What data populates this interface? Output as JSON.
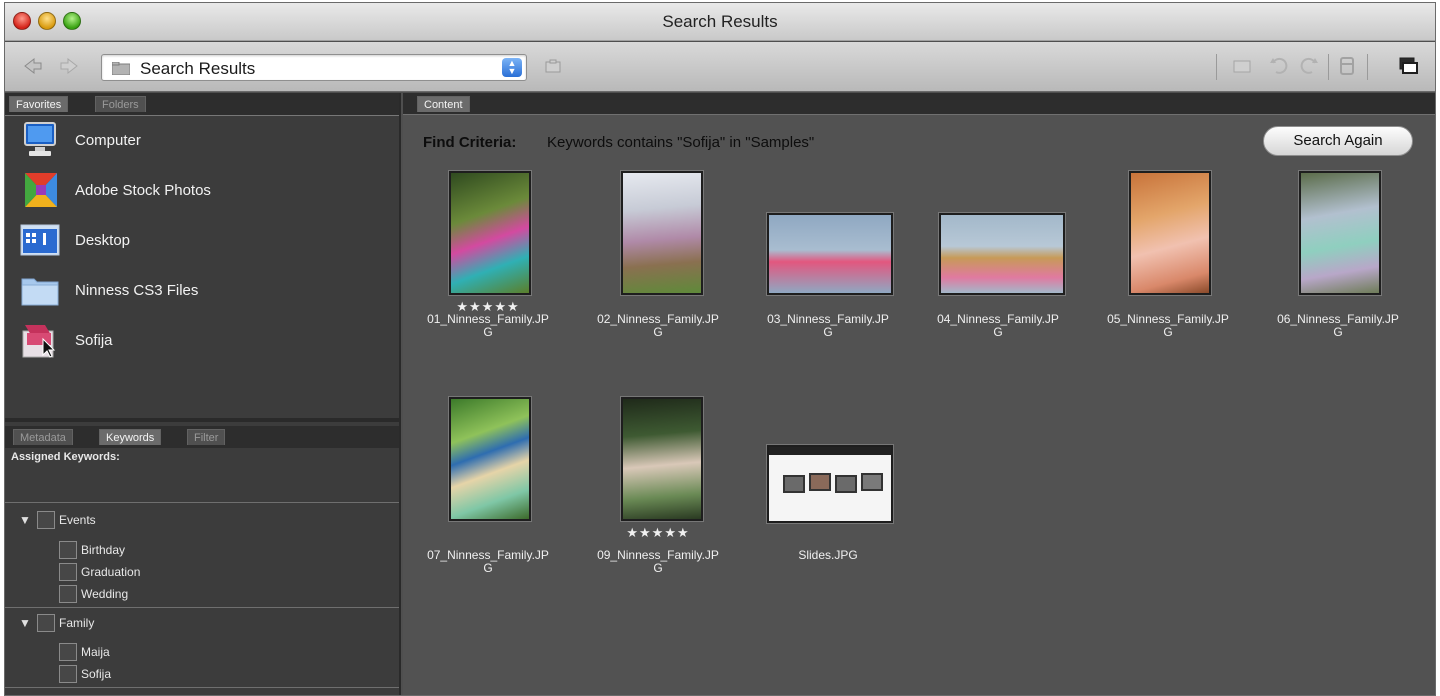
{
  "window": {
    "title": "Search Results"
  },
  "toolbar": {
    "path_text": "Search Results",
    "icons": [
      "back-arrow-icon",
      "forward-arrow-icon",
      "folder-icon",
      "dropdown-icon",
      "camera-icon",
      "thumbnail-icon",
      "rotate-left-icon",
      "rotate-right-icon",
      "trash-icon",
      "compact-mode-icon"
    ]
  },
  "left_panel": {
    "tabs": [
      "Favorites",
      "Folders"
    ],
    "favorites": [
      {
        "label": "Computer",
        "icon": "computer-icon"
      },
      {
        "label": "Adobe Stock Photos",
        "icon": "stock-photos-icon"
      },
      {
        "label": "Desktop",
        "icon": "desktop-icon"
      },
      {
        "label": "Ninness CS3 Files",
        "icon": "folder-icon"
      },
      {
        "label": "Sofija",
        "icon": "collection-icon"
      }
    ],
    "keyword_tabs": [
      "Metadata",
      "Keywords",
      "Filter"
    ],
    "assigned_label": "Assigned Keywords:",
    "keyword_groups": [
      {
        "name": "Events",
        "items": [
          "Birthday",
          "Graduation",
          "Wedding"
        ]
      },
      {
        "name": "Family",
        "items": [
          "Maija",
          "Sofija"
        ]
      }
    ]
  },
  "content": {
    "tab": "Content",
    "find_label": "Find Criteria:",
    "find_value": "Keywords contains \"Sofija\" in \"Samples\"",
    "search_again": "Search Again",
    "thumbnails": [
      {
        "name": "01_Ninness_Family.JPG",
        "line1": "01_Ninness_Family.JP",
        "line2": "G",
        "stars": "★★★★★"
      },
      {
        "name": "02_Ninness_Family.JPG",
        "line1": "02_Ninness_Family.JP",
        "line2": "G",
        "stars": ""
      },
      {
        "name": "03_Ninness_Family.JPG",
        "line1": "03_Ninness_Family.JP",
        "line2": "G",
        "stars": ""
      },
      {
        "name": "04_Ninness_Family.JPG",
        "line1": "04_Ninness_Family.JP",
        "line2": "G",
        "stars": ""
      },
      {
        "name": "05_Ninness_Family.JPG",
        "line1": "05_Ninness_Family.JP",
        "line2": "G",
        "stars": ""
      },
      {
        "name": "06_Ninness_Family.JPG",
        "line1": "06_Ninness_Family.JP",
        "line2": "G",
        "stars": ""
      },
      {
        "name": "07_Ninness_Family.JPG",
        "line1": "07_Ninness_Family.JP",
        "line2": "G",
        "stars": ""
      },
      {
        "name": "09_Ninness_Family.JPG",
        "line1": "09_Ninness_Family.JP",
        "line2": "G",
        "stars": "★★★★★"
      },
      {
        "name": "Slides.JPG",
        "line1": "Slides.JPG",
        "line2": "",
        "stars": ""
      }
    ]
  }
}
